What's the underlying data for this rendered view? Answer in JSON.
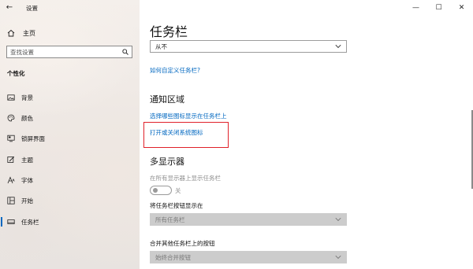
{
  "window": {
    "app_title": "设置",
    "back_icon": "back-arrow-icon",
    "controls": {
      "minimize": "—",
      "maximize": "☐",
      "close": "✕"
    }
  },
  "sidebar": {
    "home": {
      "label": "主页",
      "icon": "home-icon"
    },
    "search": {
      "placeholder": "查找设置",
      "icon": "search-icon"
    },
    "section_title": "个性化",
    "items": [
      {
        "label": "背景",
        "icon": "picture-icon"
      },
      {
        "label": "颜色",
        "icon": "palette-icon"
      },
      {
        "label": "锁屏界面",
        "icon": "lock-screen-icon"
      },
      {
        "label": "主题",
        "icon": "brush-icon"
      },
      {
        "label": "字体",
        "icon": "font-icon"
      },
      {
        "label": "开始",
        "icon": "start-icon"
      },
      {
        "label": "任务栏",
        "icon": "taskbar-icon",
        "active": true
      }
    ]
  },
  "main": {
    "title": "任务栏",
    "top_dropdown": {
      "value": "从不"
    },
    "customize_link": "如何自定义任务栏?",
    "notification_area": {
      "heading": "通知区域",
      "link_select_icons": "选择哪些图标显示在任务栏上",
      "link_toggle_system_icons": "打开或关闭系统图标"
    },
    "multi_display": {
      "heading": "多显示器",
      "show_on_all_label": "在所有显示器上显示任务栏",
      "toggle_state": "关",
      "show_buttons_label": "将任务栏按钮显示在",
      "show_buttons_value": "所有任务栏",
      "combine_label": "合并其他任务栏上的按钮",
      "combine_value": "始终合并按钮"
    }
  },
  "colors": {
    "accent": "#0067c0",
    "highlight_box": "#e0212a"
  }
}
